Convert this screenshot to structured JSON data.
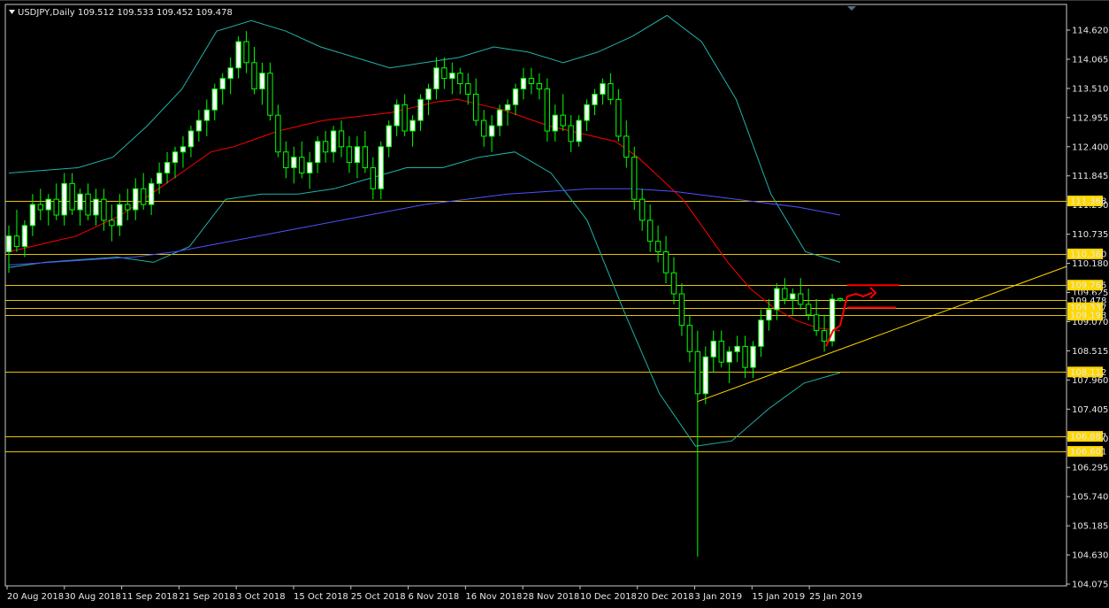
{
  "header": {
    "symbol": "USDJPY",
    "timeframe": "Daily",
    "title_text": "USDJPY,Daily  109.512 109.533 109.452 109.478"
  },
  "chart_data": {
    "type": "candlestick",
    "symbol": "USDJPY",
    "timeframe": "Daily",
    "last_bar": {
      "open": 109.512,
      "high": 109.533,
      "low": 109.452,
      "close": 109.478
    },
    "ylim": [
      104.075,
      114.62
    ],
    "y_ticks": [
      114.62,
      114.065,
      113.51,
      112.955,
      112.4,
      111.845,
      111.29,
      110.735,
      110.18,
      109.625,
      109.07,
      108.515,
      107.96,
      107.405,
      106.85,
      106.295,
      105.74,
      105.185,
      104.63,
      104.075
    ],
    "x_tick_labels": [
      "20 Aug 2018",
      "30 Aug 2018",
      "11 Sep 2018",
      "21 Sep 2018",
      "3 Oct 2018",
      "15 Oct 2018",
      "25 Oct 2018",
      "6 Nov 2018",
      "16 Nov 2018",
      "28 Nov 2018",
      "10 Dec 2018",
      "20 Dec 2018",
      "3 Jan 2019",
      "15 Jan 2019",
      "25 Jan 2019"
    ],
    "horizontal_levels": [
      {
        "value": 111.368,
        "label": "111.368"
      },
      {
        "value": 110.36,
        "label": "110.360"
      },
      {
        "value": 109.765,
        "label": "109.765"
      },
      {
        "value": 109.478,
        "label": "109.478"
      },
      {
        "value": 109.337,
        "label": "109.337"
      },
      {
        "value": 109.193,
        "label": "109.193"
      },
      {
        "value": 108.112,
        "label": "108.112"
      },
      {
        "value": 106.887,
        "label": "106.887"
      },
      {
        "value": 106.601,
        "label": "106.601"
      }
    ],
    "candles": [
      [
        110.4,
        110.9,
        110.0,
        110.7
      ],
      [
        110.7,
        111.2,
        110.4,
        110.5
      ],
      [
        110.5,
        111.0,
        110.3,
        110.9
      ],
      [
        110.9,
        111.5,
        110.7,
        111.3
      ],
      [
        111.3,
        111.6,
        111.0,
        111.2
      ],
      [
        111.2,
        111.5,
        110.9,
        111.4
      ],
      [
        111.4,
        111.7,
        111.0,
        111.1
      ],
      [
        111.1,
        111.9,
        110.9,
        111.7
      ],
      [
        111.7,
        111.9,
        111.1,
        111.2
      ],
      [
        111.2,
        111.6,
        110.9,
        111.5
      ],
      [
        111.5,
        111.7,
        111.0,
        111.1
      ],
      [
        111.1,
        111.6,
        110.9,
        111.4
      ],
      [
        111.4,
        111.6,
        110.8,
        111.0
      ],
      [
        111.0,
        111.3,
        110.6,
        110.9
      ],
      [
        110.9,
        111.5,
        110.7,
        111.3
      ],
      [
        111.3,
        111.6,
        111.0,
        111.2
      ],
      [
        111.2,
        111.8,
        111.0,
        111.6
      ],
      [
        111.6,
        111.9,
        111.2,
        111.3
      ],
      [
        111.3,
        111.8,
        111.1,
        111.7
      ],
      [
        111.7,
        112.1,
        111.5,
        111.9
      ],
      [
        111.9,
        112.3,
        111.7,
        112.1
      ],
      [
        112.1,
        112.4,
        111.8,
        112.3
      ],
      [
        112.3,
        112.6,
        112.0,
        112.4
      ],
      [
        112.4,
        112.8,
        112.2,
        112.7
      ],
      [
        112.7,
        113.1,
        112.5,
        112.9
      ],
      [
        112.9,
        113.3,
        112.6,
        113.1
      ],
      [
        113.1,
        113.6,
        112.9,
        113.5
      ],
      [
        113.5,
        113.8,
        113.2,
        113.7
      ],
      [
        113.7,
        114.1,
        113.4,
        113.9
      ],
      [
        113.9,
        114.5,
        113.7,
        114.4
      ],
      [
        114.4,
        114.6,
        113.8,
        114.0
      ],
      [
        114.0,
        114.3,
        113.4,
        113.5
      ],
      [
        113.5,
        114.0,
        113.2,
        113.8
      ],
      [
        113.8,
        114.0,
        112.9,
        113.0
      ],
      [
        113.0,
        113.2,
        112.2,
        112.3
      ],
      [
        112.3,
        112.5,
        111.8,
        112.0
      ],
      [
        112.0,
        112.4,
        111.7,
        112.2
      ],
      [
        112.2,
        112.5,
        111.8,
        111.9
      ],
      [
        111.9,
        112.3,
        111.6,
        112.1
      ],
      [
        112.1,
        112.6,
        111.9,
        112.5
      ],
      [
        112.5,
        112.7,
        112.1,
        112.3
      ],
      [
        112.3,
        112.8,
        112.1,
        112.7
      ],
      [
        112.7,
        112.9,
        112.2,
        112.4
      ],
      [
        112.4,
        112.6,
        111.9,
        112.1
      ],
      [
        112.1,
        112.6,
        111.8,
        112.4
      ],
      [
        112.4,
        112.7,
        111.9,
        112.0
      ],
      [
        112.0,
        112.2,
        111.4,
        111.6
      ],
      [
        111.6,
        112.5,
        111.4,
        112.4
      ],
      [
        112.4,
        112.9,
        112.2,
        112.8
      ],
      [
        112.8,
        113.3,
        112.6,
        113.2
      ],
      [
        113.2,
        113.4,
        112.6,
        112.7
      ],
      [
        112.7,
        113.0,
        112.4,
        112.9
      ],
      [
        112.9,
        113.4,
        112.7,
        113.3
      ],
      [
        113.3,
        113.6,
        113.0,
        113.5
      ],
      [
        113.5,
        114.1,
        113.3,
        113.9
      ],
      [
        113.9,
        114.1,
        113.5,
        113.7
      ],
      [
        113.7,
        114.0,
        113.4,
        113.8
      ],
      [
        113.8,
        113.9,
        113.4,
        113.6
      ],
      [
        113.6,
        113.8,
        113.2,
        113.4
      ],
      [
        113.4,
        113.7,
        112.8,
        112.9
      ],
      [
        112.9,
        113.1,
        112.4,
        112.6
      ],
      [
        112.6,
        113.0,
        112.3,
        112.8
      ],
      [
        112.8,
        113.2,
        112.6,
        113.1
      ],
      [
        113.1,
        113.3,
        112.8,
        113.2
      ],
      [
        113.2,
        113.6,
        113.0,
        113.5
      ],
      [
        113.5,
        113.9,
        113.3,
        113.7
      ],
      [
        113.7,
        113.9,
        113.4,
        113.6
      ],
      [
        113.6,
        113.8,
        113.3,
        113.5
      ],
      [
        113.5,
        113.7,
        112.5,
        112.7
      ],
      [
        112.7,
        113.2,
        112.5,
        113.0
      ],
      [
        113.0,
        113.4,
        112.7,
        112.8
      ],
      [
        112.8,
        113.0,
        112.3,
        112.5
      ],
      [
        112.5,
        113.0,
        112.4,
        112.9
      ],
      [
        112.9,
        113.3,
        112.7,
        113.2
      ],
      [
        113.2,
        113.5,
        113.0,
        113.4
      ],
      [
        113.4,
        113.7,
        113.2,
        113.6
      ],
      [
        113.6,
        113.8,
        113.2,
        113.3
      ],
      [
        113.3,
        113.5,
        112.5,
        112.6
      ],
      [
        112.6,
        112.9,
        112.0,
        112.2
      ],
      [
        112.2,
        112.4,
        111.2,
        111.4
      ],
      [
        111.4,
        111.6,
        110.8,
        111.0
      ],
      [
        111.0,
        111.3,
        110.4,
        110.6
      ],
      [
        110.6,
        110.9,
        110.2,
        110.4
      ],
      [
        110.4,
        110.7,
        109.8,
        110.0
      ],
      [
        110.0,
        110.3,
        109.4,
        109.6
      ],
      [
        109.6,
        109.8,
        108.8,
        109.0
      ],
      [
        109.0,
        109.2,
        108.3,
        108.5
      ],
      [
        108.5,
        108.9,
        104.6,
        107.7
      ],
      [
        107.7,
        108.6,
        107.5,
        108.4
      ],
      [
        108.4,
        108.9,
        108.1,
        108.7
      ],
      [
        108.7,
        108.9,
        108.2,
        108.3
      ],
      [
        108.3,
        108.6,
        107.9,
        108.5
      ],
      [
        108.5,
        108.8,
        108.3,
        108.6
      ],
      [
        108.6,
        108.8,
        108.0,
        108.2
      ],
      [
        108.2,
        108.7,
        108.0,
        108.6
      ],
      [
        108.6,
        109.3,
        108.4,
        109.1
      ],
      [
        109.1,
        109.5,
        108.9,
        109.3
      ],
      [
        109.3,
        109.8,
        109.1,
        109.7
      ],
      [
        109.7,
        109.9,
        109.4,
        109.5
      ],
      [
        109.5,
        109.7,
        109.2,
        109.6
      ],
      [
        109.6,
        109.9,
        109.3,
        109.4
      ],
      [
        109.4,
        109.7,
        109.1,
        109.2
      ],
      [
        109.2,
        109.5,
        108.8,
        108.9
      ],
      [
        108.9,
        109.2,
        108.5,
        108.7
      ],
      [
        108.7,
        109.6,
        108.6,
        109.5
      ],
      [
        109.51,
        109.53,
        109.45,
        109.48
      ]
    ],
    "ma_red": [
      110.4,
      110.5,
      110.6,
      110.7,
      110.9,
      111.1,
      111.4,
      111.7,
      112.0,
      112.3,
      112.4,
      112.55,
      112.7,
      112.8,
      112.9,
      112.95,
      113.0,
      113.05,
      113.15,
      113.25,
      113.3,
      113.2,
      113.1,
      112.95,
      112.8,
      112.7,
      112.6,
      112.5,
      112.2,
      111.8,
      111.4,
      110.8,
      110.2,
      109.7,
      109.35,
      109.1,
      108.95,
      108.9
    ],
    "ma_blue": [
      110.15,
      110.2,
      110.25,
      110.3,
      110.4,
      110.55,
      110.7,
      110.85,
      111.0,
      111.15,
      111.3,
      111.4,
      111.5,
      111.55,
      111.6,
      111.6,
      111.55,
      111.45,
      111.35,
      111.25,
      111.1
    ],
    "bb_upper": [
      111.9,
      111.95,
      112.0,
      112.2,
      112.8,
      113.5,
      114.6,
      114.8,
      114.6,
      114.3,
      114.1,
      113.9,
      114.0,
      114.1,
      114.3,
      114.2,
      114.0,
      114.2,
      114.5,
      114.9,
      114.4,
      113.3,
      111.5,
      110.4,
      110.2
    ],
    "bb_lower": [
      110.1,
      110.2,
      110.25,
      110.3,
      110.2,
      110.5,
      111.4,
      111.5,
      111.5,
      111.6,
      111.8,
      112.0,
      112.0,
      112.2,
      112.3,
      111.9,
      111.0,
      109.3,
      107.7,
      106.7,
      106.8,
      107.4,
      107.9,
      108.1
    ],
    "trend_line_start": {
      "bar": 0,
      "value": 107.55
    },
    "trend_line_end": {
      "bar": 1,
      "value": 110.12
    },
    "colors": {
      "background": "#000000",
      "bull_body": "#ffffff",
      "bear_body": "#000000",
      "candle_wick": "#00ff00",
      "ma_red": "#ff0000",
      "ma_blue": "#5050ff",
      "bollinger": "#20b2aa",
      "level_line": "#ffd700",
      "level_label_bg": "#ffd700",
      "projection": "#ff0000"
    },
    "grid": false
  }
}
